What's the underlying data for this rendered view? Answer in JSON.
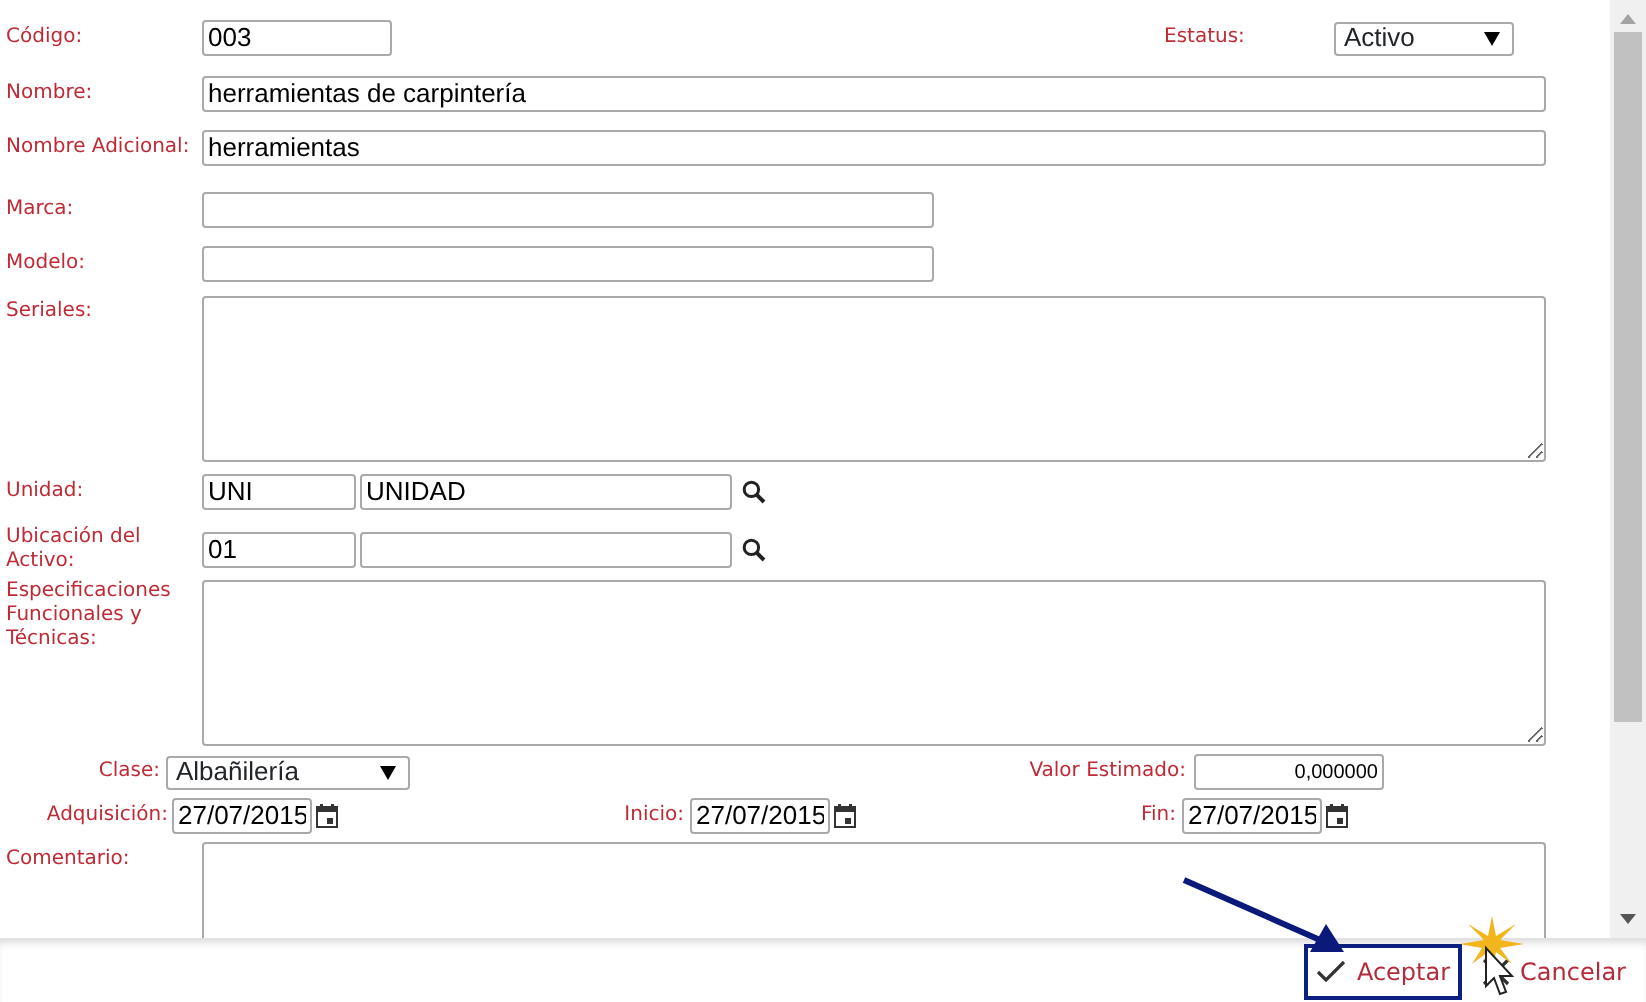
{
  "form": {
    "code": {
      "label": "Código:",
      "value": "003"
    },
    "status": {
      "label": "Estatus:",
      "value": "Activo"
    },
    "name": {
      "label": "Nombre:",
      "value": "herramientas de carpintería"
    },
    "additional_name": {
      "label": "Nombre Adicional:",
      "value": "herramientas"
    },
    "brand": {
      "label": "Marca:"
    },
    "model": {
      "label": "Modelo:"
    },
    "serials": {
      "label": "Seriales:"
    },
    "unit": {
      "label": "Unidad:",
      "code": "UNI",
      "description": "UNIDAD"
    },
    "location": {
      "label": "Ubicación del Activo:",
      "code": "01"
    },
    "specifications": {
      "label": "Especificaciones Funcionales y Técnicas:"
    },
    "asset_class": {
      "label": "Clase:",
      "value": "Albañilería"
    },
    "estimated_value": {
      "label": "Valor Estimado:",
      "value": "0,000000"
    },
    "acquisition": {
      "label": "Adquisición:",
      "value": "27/07/2015"
    },
    "start": {
      "label": "Inicio:",
      "value": "27/07/2015"
    },
    "end": {
      "label": "Fin:",
      "value": "27/07/2015"
    },
    "comment": {
      "label": "Comentario:"
    }
  },
  "footer": {
    "buttons": [
      {
        "label": "Aceptar",
        "kind": "accept",
        "highlighted": true
      },
      {
        "label": "Cancelar",
        "kind": "cancel",
        "highlighted": false
      }
    ]
  }
}
